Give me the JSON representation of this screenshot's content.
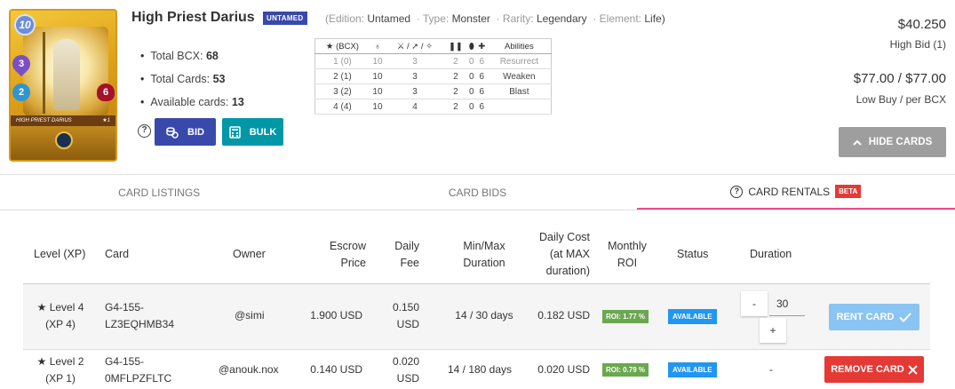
{
  "card": {
    "name": "High Priest Darius",
    "badge": "UNTAMED",
    "mana": "10",
    "magic": "3",
    "speed": "2",
    "health": "6",
    "art_name": "HIGH PRIEST DARIUS",
    "art_count": "★1"
  },
  "meta": {
    "edition_label": "(Edition:",
    "edition": "Untamed",
    "type_label": "· Type:",
    "type": "Monster",
    "rarity_label": "· Rarity:",
    "rarity": "Legendary",
    "element_label": "· Element:",
    "element": "Life)"
  },
  "info": {
    "bcx_label": "Total BCX:",
    "bcx": "68",
    "cards_label": "Total Cards:",
    "cards": "53",
    "available_label": "Available cards:",
    "available": "13"
  },
  "buttons": {
    "bid": "BID",
    "bulk": "BULK",
    "hide": "HIDE CARDS"
  },
  "level_table": {
    "headers": [
      "★ (BCX)",
      "♁",
      "⚔ / ➚ / ✧",
      "❚❚",
      "⬮",
      "✚",
      "Abilities"
    ],
    "rows": [
      [
        "1 (0)",
        "10",
        "3",
        "2",
        "0",
        "6",
        "Resurrect"
      ],
      [
        "2 (1)",
        "10",
        "3",
        "2",
        "0",
        "6",
        "Weaken"
      ],
      [
        "3 (2)",
        "10",
        "3",
        "2",
        "0",
        "6",
        "Blast"
      ],
      [
        "4 (4)",
        "10",
        "4",
        "2",
        "0",
        "6",
        ""
      ]
    ]
  },
  "prices": {
    "high_bid": "$40.250",
    "high_bid_label": "High Bid (1)",
    "low_buy": "$77.00 / $77.00",
    "low_buy_label": "Low Buy / per BCX"
  },
  "tabs": {
    "listings": "CARD LISTINGS",
    "bids": "CARD BIDS",
    "rentals": "CARD RENTALS",
    "beta": "BETA"
  },
  "rentals": {
    "headers": {
      "level": "Level (XP)",
      "card": "Card",
      "owner": "Owner",
      "escrow": [
        "Escrow",
        "Price"
      ],
      "daily_fee": [
        "Daily",
        "Fee"
      ],
      "minmax": [
        "Min/Max",
        "Duration"
      ],
      "daily_cost": [
        "Daily Cost",
        "(at MAX",
        "duration)"
      ],
      "monthly_roi": [
        "Monthly",
        "ROI"
      ],
      "status": "Status",
      "duration": "Duration"
    },
    "rows": [
      {
        "level": "Level 4",
        "xp": "(XP 4)",
        "card_id": [
          "G4-155-",
          "LZ3EQHMB34"
        ],
        "owner": "@simi",
        "escrow": "1.900 USD",
        "daily_fee": [
          "0.150",
          "USD"
        ],
        "minmax": "14 / 30 days",
        "daily_cost": "0.182 USD",
        "roi": "ROI: 1.77 %",
        "status": "AVAILABLE",
        "duration_minus": "-",
        "duration_value": "30",
        "duration_plus": "+",
        "action": "RENT CARD"
      },
      {
        "level": "Level 2",
        "xp": "(XP 1)",
        "card_id": [
          "G4-155-",
          "0MFLPZFLTC"
        ],
        "owner": "@anouk.nox",
        "escrow": "0.140 USD",
        "daily_fee": [
          "0.020",
          "USD"
        ],
        "minmax": "14 / 180 days",
        "daily_cost": "0.020 USD",
        "roi": "ROI: 0.79 %",
        "status": "AVAILABLE",
        "duration": "-",
        "action": "REMOVE CARD"
      }
    ]
  },
  "colors": {
    "indigo": "#3949ab",
    "teal": "#0097a7",
    "grey": "#9e9e9e",
    "red": "#e53935",
    "blue": "#2196f3",
    "green": "#6aa84f",
    "pink": "#e84d8a"
  }
}
